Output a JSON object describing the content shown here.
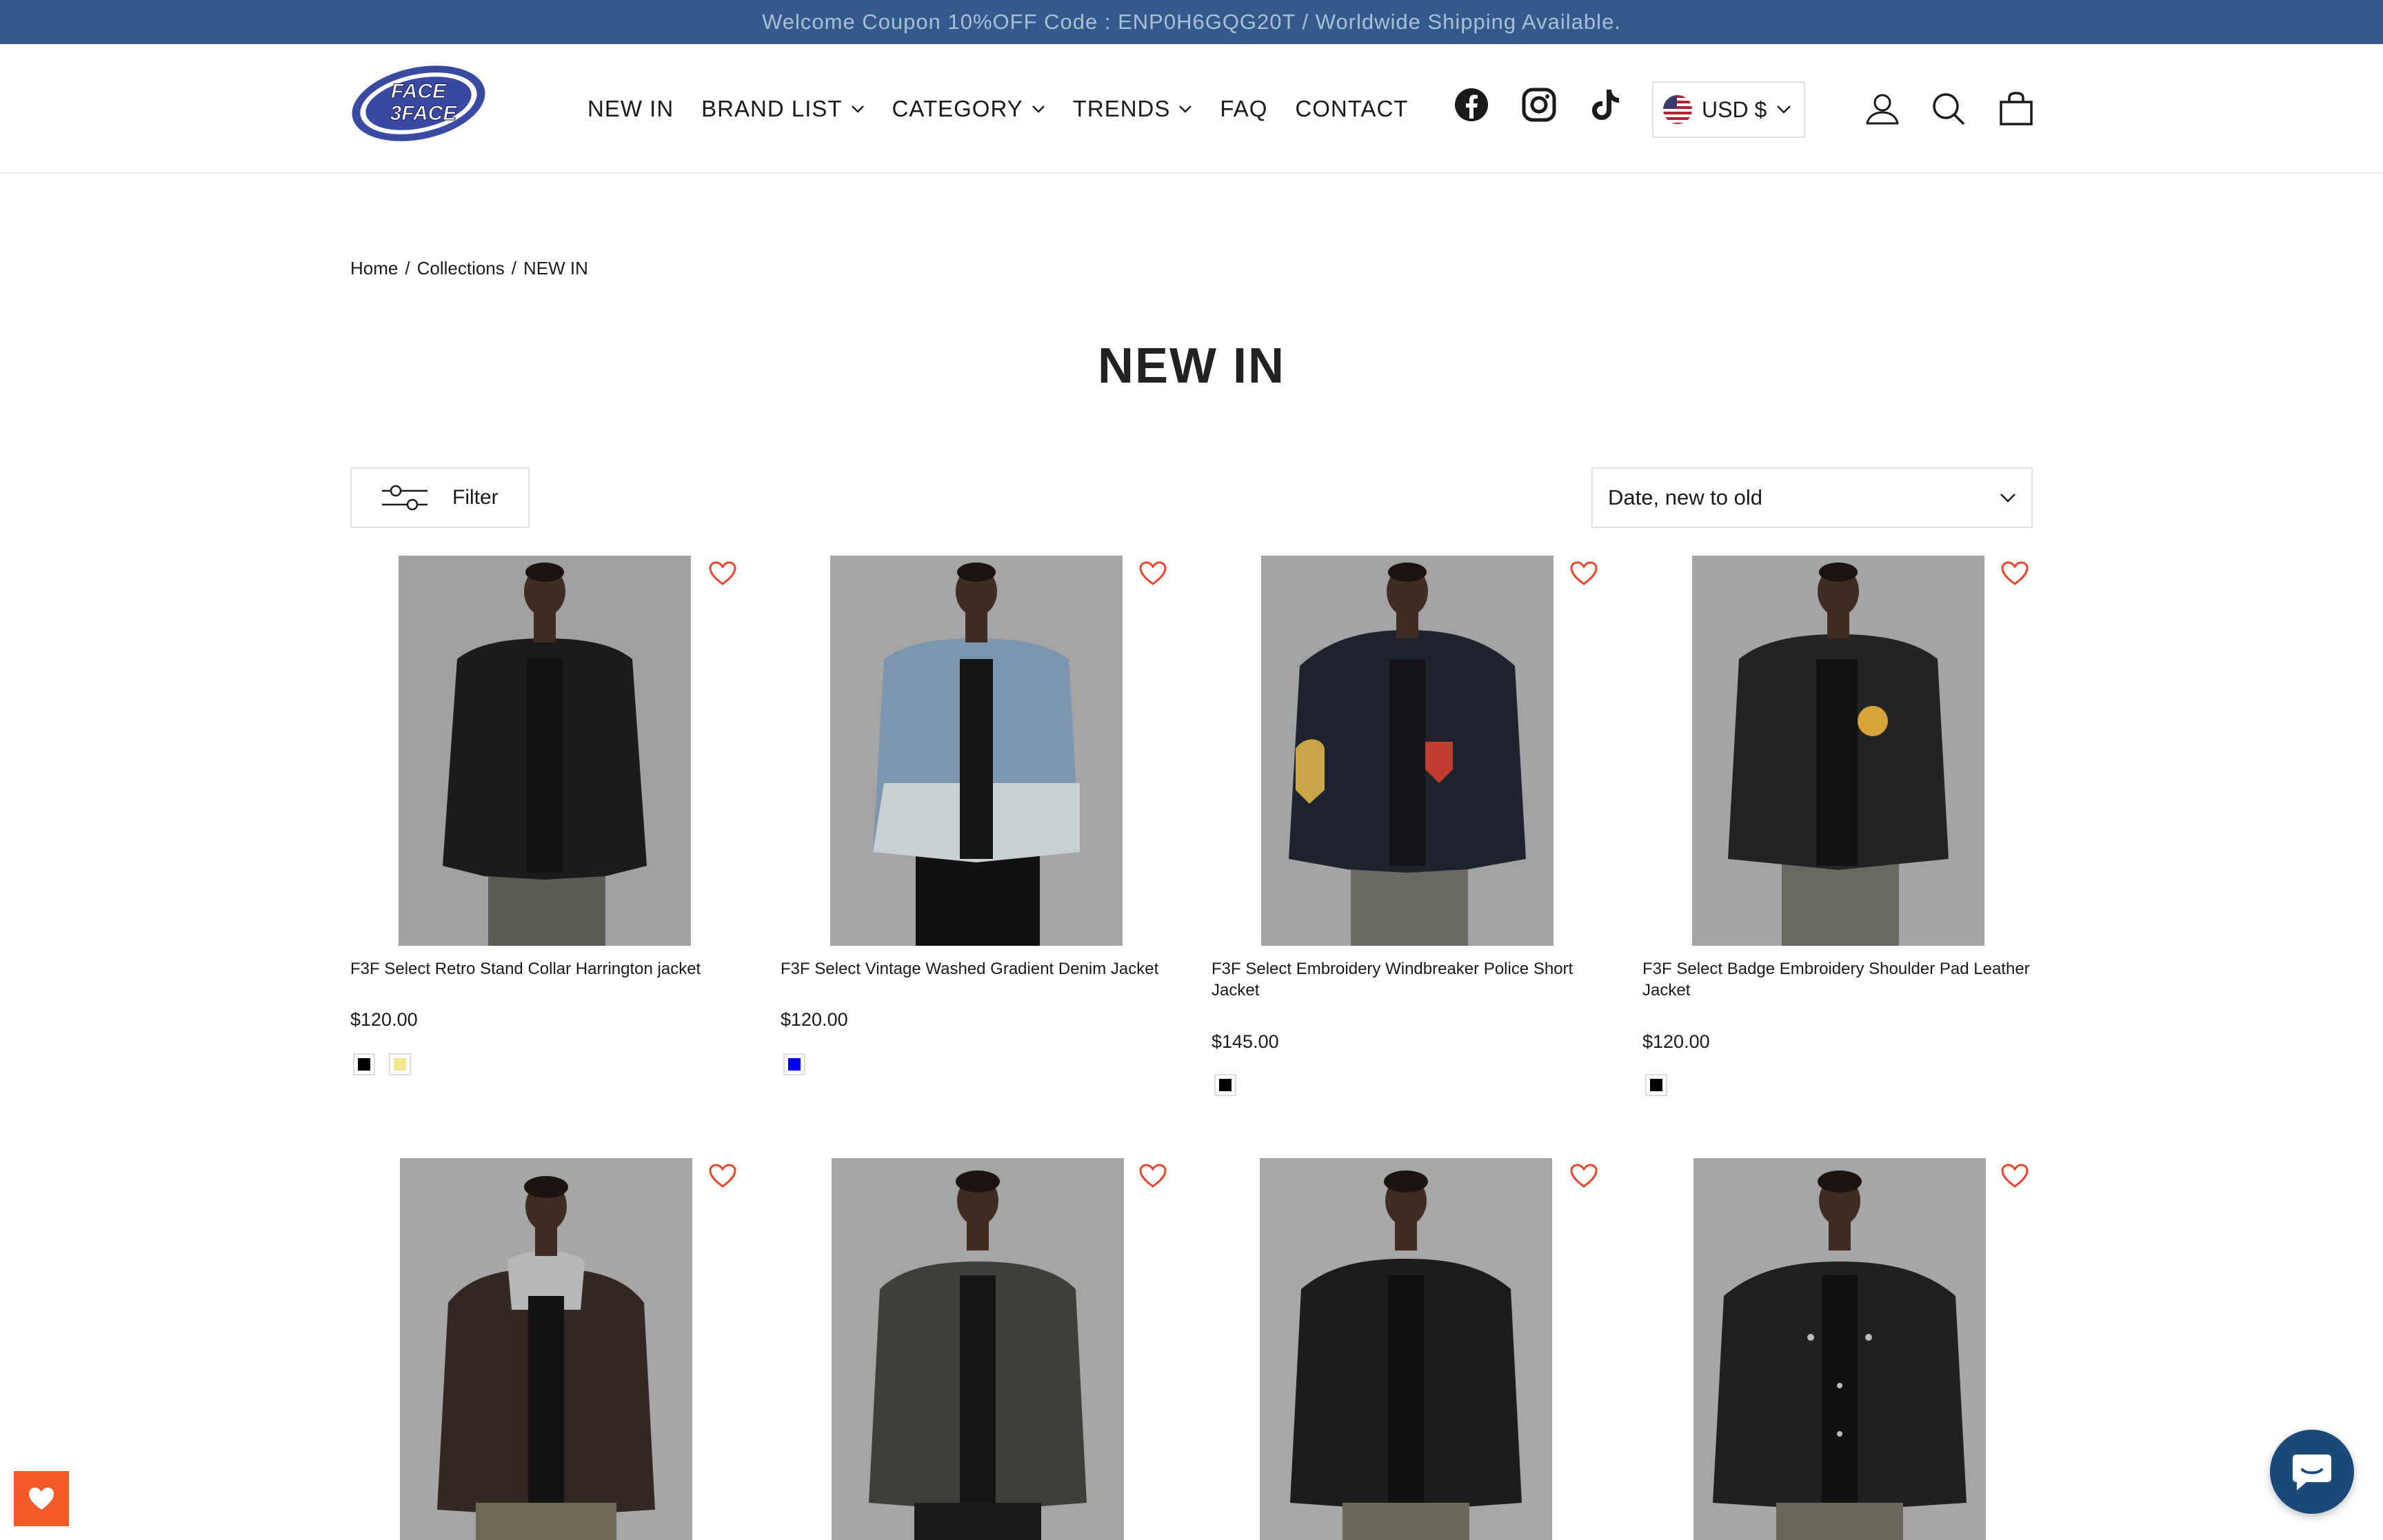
{
  "announcement": "Welcome Coupon 10%OFF Code : ENP0H6GQG20T / Worldwide Shipping Available.",
  "brand": {
    "logo_text": "FACE3FACE",
    "logo_icon": "face3face-logo"
  },
  "nav": [
    {
      "label": "NEW IN",
      "dropdown": false
    },
    {
      "label": "BRAND LIST",
      "dropdown": true
    },
    {
      "label": "CATEGORY",
      "dropdown": true
    },
    {
      "label": "TRENDS",
      "dropdown": true
    },
    {
      "label": "FAQ",
      "dropdown": false
    },
    {
      "label": "CONTACT",
      "dropdown": false
    }
  ],
  "social": [
    "facebook-icon",
    "instagram-icon",
    "tiktok-icon"
  ],
  "currency": {
    "label": "USD $",
    "flag": "us-flag-icon"
  },
  "header_icons": [
    "account-icon",
    "search-icon",
    "cart-icon"
  ],
  "breadcrumb": {
    "home": "Home",
    "sep1": "/",
    "collections": "Collections",
    "sep2": "/",
    "current": "NEW IN"
  },
  "page_title": "NEW IN",
  "filter": {
    "label": "Filter",
    "icon": "filter-sliders-icon"
  },
  "sort": {
    "selected": "Date, new to old"
  },
  "products": [
    {
      "name": "F3F Select Retro Stand Collar Harrington jacket",
      "price": "$120.00",
      "swatches": [
        "#000000",
        "#f0e68c"
      ]
    },
    {
      "name": "F3F Select Vintage Washed Gradient Denim Jacket",
      "price": "$120.00",
      "swatches": [
        "#0000ff"
      ]
    },
    {
      "name": "F3F Select Embroidery Windbreaker Police Short Jacket",
      "price": "$145.00",
      "swatches": [
        "#000000"
      ]
    },
    {
      "name": "F3F Select Badge Embroidery Shoulder Pad Leather Jacket",
      "price": "$120.00",
      "swatches": [
        "#000000"
      ]
    },
    {
      "name": "",
      "price": "",
      "swatches": []
    },
    {
      "name": "",
      "price": "",
      "swatches": []
    },
    {
      "name": "",
      "price": "",
      "swatches": []
    },
    {
      "name": "",
      "price": "",
      "swatches": []
    }
  ],
  "colors": {
    "accent": "#f25a29",
    "announce_bg": "#335a8b",
    "chat_bg": "#1c4a78",
    "wishlist_heart": "#e8452c"
  }
}
